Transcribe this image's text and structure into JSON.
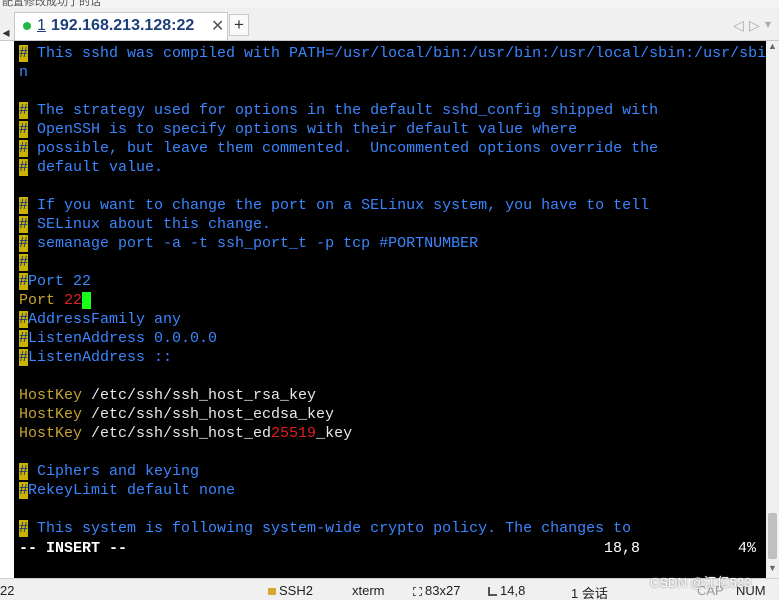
{
  "window": {
    "top_text": "配置修改成功了的话"
  },
  "tabbar": {
    "left_arrow": "◂",
    "tab": {
      "number": "1",
      "title": "192.168.213.128:22",
      "close": "✕"
    },
    "add": "+",
    "prev": "◁",
    "next": "▷",
    "menu": "▾"
  },
  "terminal": {
    "lines": [
      {
        "hash": "#",
        "text": " This sshd was compiled with PATH=/usr/local/bin:/usr/bin:/usr/local/sbin:/usr/sbi"
      },
      {
        "text": "n"
      },
      {
        "hash": "#",
        "text": " The strategy used for options in the default sshd_config shipped with"
      },
      {
        "hash": "#",
        "text": " OpenSSH is to specify options with their default value where"
      },
      {
        "hash": "#",
        "text": " possible, but leave them commented.  Uncommented options override the"
      },
      {
        "hash": "#",
        "text": " default value."
      },
      {
        "hash": "#",
        "text": " If you want to change the port on a SELinux system, you have to tell"
      },
      {
        "hash": "#",
        "text": " SELinux about this change."
      },
      {
        "hash": "#",
        "text": " semanage port -a -t ssh_port_t -p tcp #PORTNUMBER"
      },
      {
        "hash": "#",
        "text": ""
      },
      {
        "hash": "#",
        "text": "Port 22"
      },
      {
        "kw": "Port ",
        "red": "22",
        "cursor": " "
      },
      {
        "hash": "#",
        "text": "AddressFamily any"
      },
      {
        "hash": "#",
        "text": "ListenAddress 0.0.0.0"
      },
      {
        "hash": "#",
        "text": "ListenAddress ::"
      },
      {
        "kw": "HostKey ",
        "wt": "/etc/ssh/ssh_host_rsa_key"
      },
      {
        "kw": "HostKey ",
        "wt": "/etc/ssh/ssh_host_ecdsa_key"
      },
      {
        "kw": "HostKey ",
        "wt": "/etc/ssh/ssh_host_ed",
        "red": "25519",
        "wt2": "_key"
      },
      {
        "hash": "#",
        "text": " Ciphers and keying"
      },
      {
        "hash": "#",
        "text": "RekeyLimit default none"
      },
      {
        "hash": "#",
        "text": " This system is following system-wide crypto policy. The changes to"
      }
    ],
    "mode": "-- INSERT --",
    "position": "18,8",
    "percent": "4%"
  },
  "statusbar": {
    "left": "22",
    "protocol": "SSH2",
    "term": "xterm",
    "size": "83x27",
    "cursor": "14,8",
    "sessions": "1 会话",
    "cap": "CAP",
    "num": "NUM",
    "watermark": "CSDN @江亿523"
  },
  "colors": {
    "comment": "#3b86ff",
    "hash_bg": "#c9b300",
    "keyword": "#c7a431",
    "number": "#e02020",
    "cursor": "#1aff1a",
    "background": "#000000"
  }
}
